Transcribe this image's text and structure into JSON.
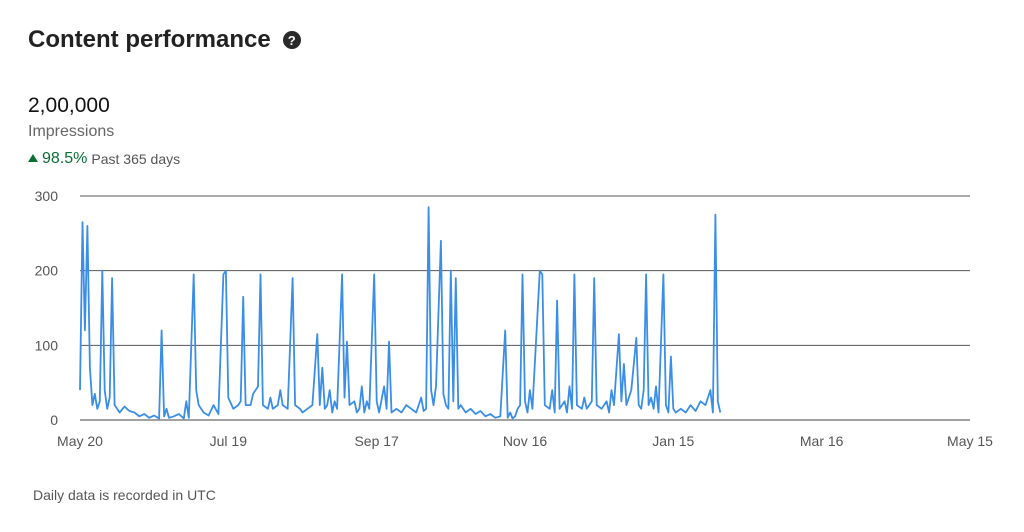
{
  "header": {
    "title": "Content performance",
    "help_icon": "question-circle-icon"
  },
  "metric": {
    "value": "2,00,000",
    "label": "Impressions",
    "change_pct": "98.5%",
    "change_direction": "up",
    "change_period": "Past 365 days",
    "change_color": "#0a6e33"
  },
  "footnote": "Daily data is recorded in UTC",
  "chart_data": {
    "type": "line",
    "title": "",
    "xlabel": "",
    "ylabel": "",
    "ylim": [
      0,
      300
    ],
    "yticks": [
      0,
      100,
      200,
      300
    ],
    "y_tick_labels": [
      "0",
      "100",
      "200",
      "300"
    ],
    "x_day_range": [
      0,
      360
    ],
    "x_ticks": [
      {
        "label": "May 20",
        "day": 0
      },
      {
        "label": "Jul 19",
        "day": 60
      },
      {
        "label": "Sep 17",
        "day": 120
      },
      {
        "label": "Nov 16",
        "day": 180
      },
      {
        "label": "Jan 15",
        "day": 240
      },
      {
        "label": "Mar 16",
        "day": 300
      },
      {
        "label": "May 15",
        "day": 360
      }
    ],
    "grid": "horizontal",
    "line_color": "#3b8ee6",
    "series": [
      {
        "name": "",
        "points": [
          [
            0,
            40
          ],
          [
            1,
            265
          ],
          [
            2,
            120
          ],
          [
            3,
            260
          ],
          [
            4,
            70
          ],
          [
            5,
            20
          ],
          [
            6,
            35
          ],
          [
            7,
            15
          ],
          [
            8,
            25
          ],
          [
            9,
            200
          ],
          [
            10,
            40
          ],
          [
            11,
            15
          ],
          [
            12,
            30
          ],
          [
            13,
            190
          ],
          [
            14,
            20
          ],
          [
            15,
            15
          ],
          [
            16,
            10
          ],
          [
            18,
            18
          ],
          [
            20,
            12
          ],
          [
            22,
            10
          ],
          [
            24,
            5
          ],
          [
            26,
            8
          ],
          [
            28,
            3
          ],
          [
            30,
            6
          ],
          [
            32,
            2
          ],
          [
            33,
            120
          ],
          [
            34,
            5
          ],
          [
            35,
            15
          ],
          [
            36,
            3
          ],
          [
            38,
            5
          ],
          [
            40,
            8
          ],
          [
            42,
            2
          ],
          [
            43,
            25
          ],
          [
            44,
            3
          ],
          [
            46,
            195
          ],
          [
            47,
            40
          ],
          [
            48,
            20
          ],
          [
            50,
            10
          ],
          [
            52,
            6
          ],
          [
            54,
            20
          ],
          [
            56,
            8
          ],
          [
            58,
            195
          ],
          [
            59,
            200
          ],
          [
            60,
            30
          ],
          [
            62,
            15
          ],
          [
            64,
            20
          ],
          [
            65,
            25
          ],
          [
            66,
            165
          ],
          [
            67,
            20
          ],
          [
            69,
            20
          ],
          [
            70,
            35
          ],
          [
            72,
            45
          ],
          [
            73,
            195
          ],
          [
            74,
            20
          ],
          [
            76,
            15
          ],
          [
            77,
            30
          ],
          [
            78,
            15
          ],
          [
            80,
            20
          ],
          [
            81,
            40
          ],
          [
            82,
            20
          ],
          [
            84,
            15
          ],
          [
            86,
            190
          ],
          [
            87,
            20
          ],
          [
            89,
            15
          ],
          [
            90,
            10
          ],
          [
            92,
            15
          ],
          [
            94,
            20
          ],
          [
            96,
            115
          ],
          [
            97,
            20
          ],
          [
            98,
            70
          ],
          [
            99,
            15
          ],
          [
            100,
            20
          ],
          [
            101,
            40
          ],
          [
            102,
            10
          ],
          [
            103,
            25
          ],
          [
            104,
            15
          ],
          [
            106,
            195
          ],
          [
            107,
            30
          ],
          [
            108,
            105
          ],
          [
            109,
            20
          ],
          [
            111,
            25
          ],
          [
            112,
            10
          ],
          [
            113,
            15
          ],
          [
            114,
            45
          ],
          [
            115,
            10
          ],
          [
            116,
            25
          ],
          [
            117,
            15
          ],
          [
            119,
            195
          ],
          [
            120,
            25
          ],
          [
            121,
            10
          ],
          [
            123,
            45
          ],
          [
            124,
            15
          ],
          [
            125,
            105
          ],
          [
            126,
            10
          ],
          [
            128,
            15
          ],
          [
            130,
            10
          ],
          [
            132,
            20
          ],
          [
            134,
            15
          ],
          [
            136,
            10
          ],
          [
            138,
            30
          ],
          [
            139,
            12
          ],
          [
            140,
            15
          ],
          [
            141,
            285
          ],
          [
            142,
            40
          ],
          [
            143,
            20
          ],
          [
            144,
            45
          ],
          [
            146,
            240
          ],
          [
            147,
            35
          ],
          [
            148,
            20
          ],
          [
            149,
            15
          ],
          [
            150,
            200
          ],
          [
            151,
            25
          ],
          [
            152,
            190
          ],
          [
            153,
            15
          ],
          [
            154,
            20
          ],
          [
            156,
            10
          ],
          [
            158,
            15
          ],
          [
            160,
            8
          ],
          [
            162,
            12
          ],
          [
            164,
            5
          ],
          [
            166,
            8
          ],
          [
            168,
            3
          ],
          [
            170,
            5
          ],
          [
            172,
            120
          ],
          [
            173,
            3
          ],
          [
            174,
            10
          ],
          [
            175,
            2
          ],
          [
            176,
            5
          ],
          [
            177,
            15
          ],
          [
            178,
            20
          ],
          [
            179,
            195
          ],
          [
            180,
            25
          ],
          [
            181,
            10
          ],
          [
            182,
            40
          ],
          [
            183,
            15
          ],
          [
            186,
            200
          ],
          [
            187,
            195
          ],
          [
            188,
            20
          ],
          [
            190,
            15
          ],
          [
            191,
            40
          ],
          [
            192,
            10
          ],
          [
            193,
            160
          ],
          [
            194,
            15
          ],
          [
            196,
            25
          ],
          [
            197,
            10
          ],
          [
            198,
            45
          ],
          [
            199,
            15
          ],
          [
            200,
            195
          ],
          [
            201,
            20
          ],
          [
            203,
            15
          ],
          [
            204,
            30
          ],
          [
            205,
            15
          ],
          [
            207,
            25
          ],
          [
            208,
            190
          ],
          [
            209,
            20
          ],
          [
            211,
            15
          ],
          [
            213,
            25
          ],
          [
            214,
            10
          ],
          [
            215,
            40
          ],
          [
            216,
            20
          ],
          [
            218,
            115
          ],
          [
            219,
            25
          ],
          [
            220,
            75
          ],
          [
            221,
            20
          ],
          [
            223,
            40
          ],
          [
            225,
            110
          ],
          [
            226,
            20
          ],
          [
            227,
            15
          ],
          [
            228,
            40
          ],
          [
            229,
            195
          ],
          [
            230,
            20
          ],
          [
            231,
            30
          ],
          [
            232,
            15
          ],
          [
            233,
            45
          ],
          [
            234,
            10
          ],
          [
            236,
            195
          ],
          [
            237,
            20
          ],
          [
            238,
            10
          ],
          [
            239,
            85
          ],
          [
            240,
            15
          ],
          [
            241,
            10
          ],
          [
            243,
            15
          ],
          [
            245,
            10
          ],
          [
            247,
            20
          ],
          [
            249,
            12
          ],
          [
            251,
            25
          ],
          [
            253,
            20
          ],
          [
            255,
            40
          ],
          [
            256,
            10
          ],
          [
            257,
            275
          ],
          [
            258,
            25
          ],
          [
            259,
            10
          ]
        ]
      }
    ]
  }
}
